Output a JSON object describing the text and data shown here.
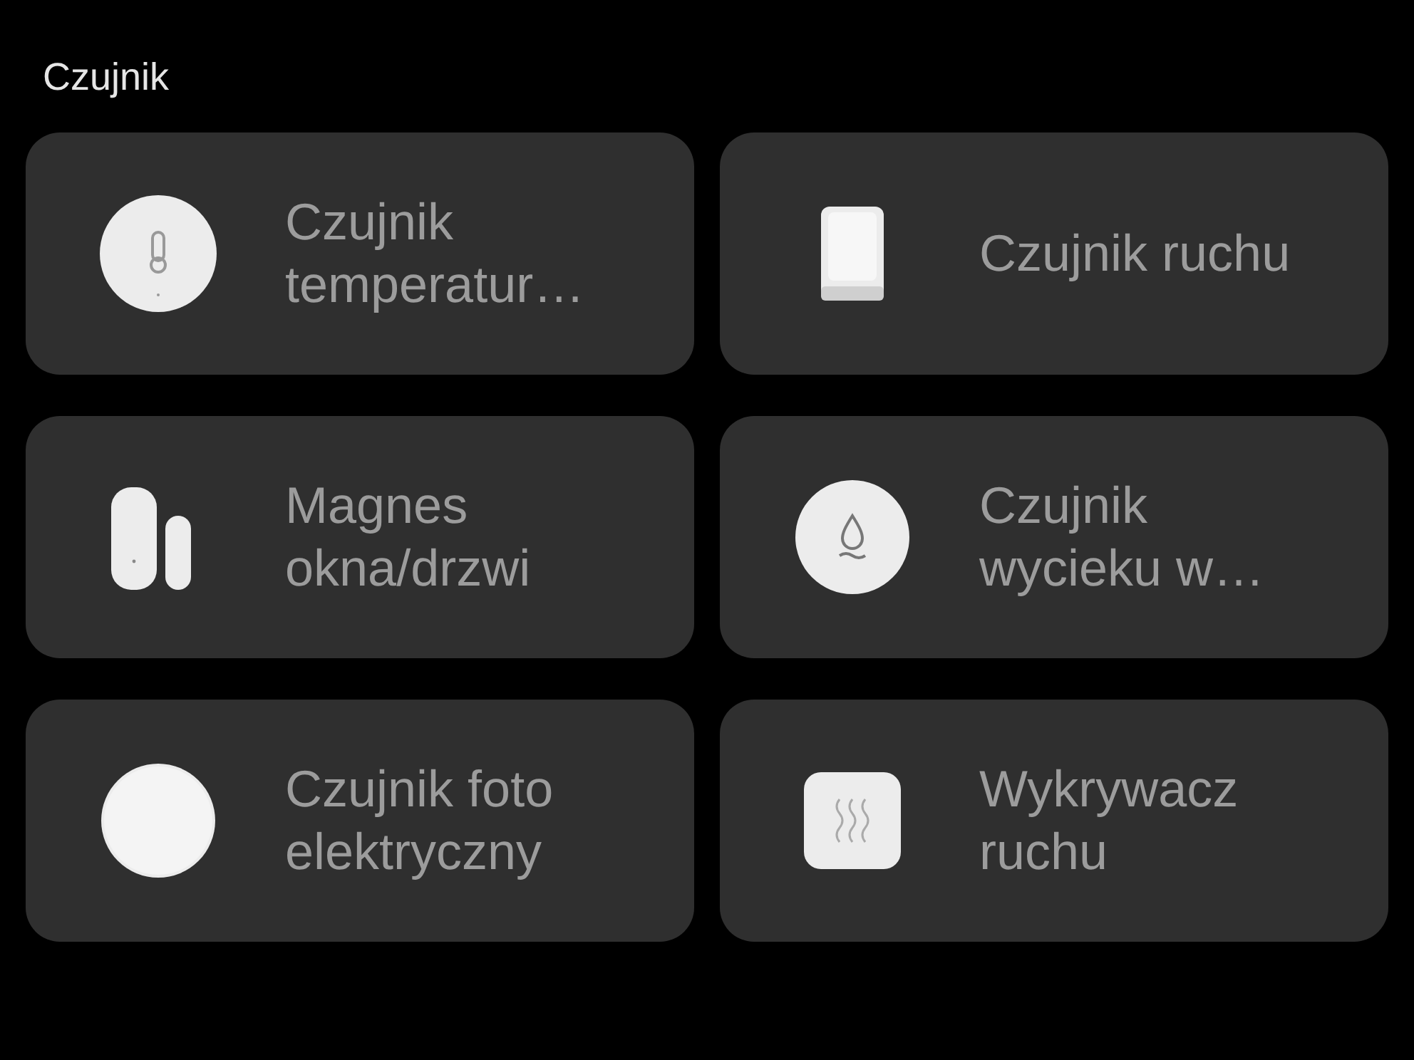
{
  "section": {
    "title": "Czujnik"
  },
  "devices": [
    {
      "label": "Czujnik temperatur…",
      "kind": "thermometer"
    },
    {
      "label": "Czujnik ruchu",
      "kind": "motion"
    },
    {
      "label": "Magnes okna/drzwi",
      "kind": "door"
    },
    {
      "label": "Czujnik wycieku w…",
      "kind": "water"
    },
    {
      "label": "Czujnik foto elektryczny",
      "kind": "light"
    },
    {
      "label": "Wykrywacz ruchu",
      "kind": "vibration"
    }
  ]
}
